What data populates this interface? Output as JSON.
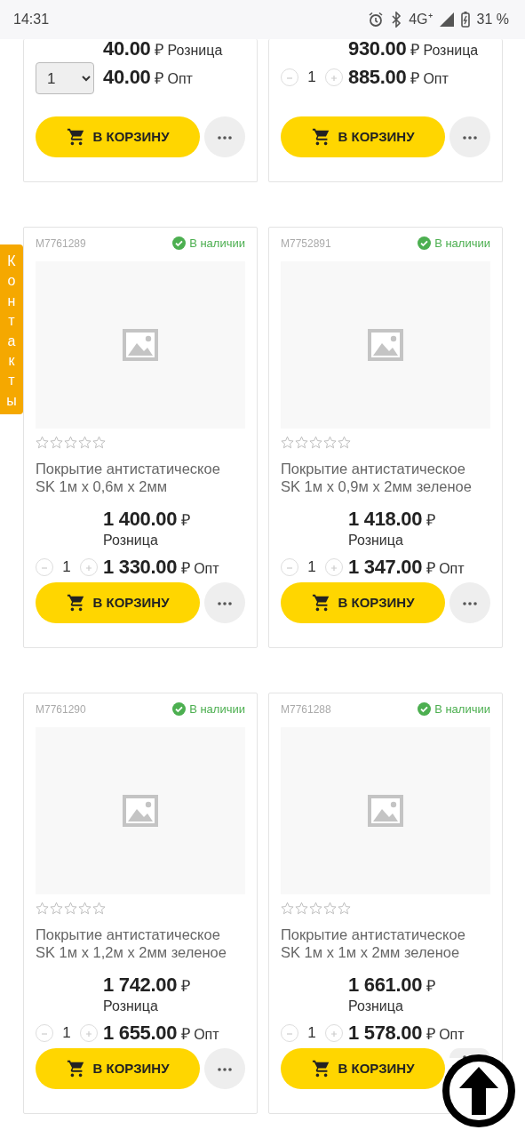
{
  "status_bar": {
    "time": "14:31",
    "network": "4G⁺",
    "battery": "31 %"
  },
  "side_tab": {
    "label": "Контакты"
  },
  "products": [
    {
      "retail_price": "40.00",
      "retail_currency": "₽",
      "retail_label": "Розница",
      "quantity": {
        "kind": "select",
        "value": "1"
      },
      "wholesale_price": "40.00",
      "wholesale_currency": "₽",
      "wholesale_label": "Опт",
      "button": "В КОРЗИНУ"
    },
    {
      "retail_price": "930.00",
      "retail_currency": "₽",
      "retail_label": "Розница",
      "quantity": {
        "kind": "stepper",
        "value": "1"
      },
      "wholesale_price": "885.00",
      "wholesale_currency": "₽",
      "wholesale_label": "Опт",
      "button": "В КОРЗИНУ"
    },
    {
      "code": "M7761289",
      "in_stock": true,
      "stock_label": "В наличии",
      "stars": 0,
      "title": "Покрытие антистатическое SK 1м х 0,6м х 2мм",
      "retail_price": "1 400.00",
      "retail_currency": "₽",
      "retail_label": "Розница",
      "quantity": {
        "kind": "stepper",
        "value": "1"
      },
      "wholesale_price": "1 330.00",
      "wholesale_currency": "₽",
      "wholesale_label": "Опт",
      "button": "В КОРЗИНУ"
    },
    {
      "code": "M7752891",
      "in_stock": true,
      "stock_label": "В наличии",
      "stars": 0,
      "title": "Покрытие антистатическое SK 1м х 0,9м х 2мм зеленое",
      "retail_price": "1 418.00",
      "retail_currency": "₽",
      "retail_label": "Розница",
      "quantity": {
        "kind": "stepper",
        "value": "1"
      },
      "wholesale_price": "1 347.00",
      "wholesale_currency": "₽",
      "wholesale_label": "Опт",
      "button": "В КОРЗИНУ"
    },
    {
      "code": "M7761290",
      "in_stock": true,
      "stock_label": "В наличии",
      "stars": 0,
      "title": "Покрытие антистатическое SK 1м х 1,2м х 2мм зеленое",
      "retail_price": "1 742.00",
      "retail_currency": "₽",
      "retail_label": "Розница",
      "quantity": {
        "kind": "stepper",
        "value": "1"
      },
      "wholesale_price": "1 655.00",
      "wholesale_currency": "₽",
      "wholesale_label": "Опт",
      "button": "В КОРЗИНУ"
    },
    {
      "code": "M7761288",
      "in_stock": true,
      "stock_label": "В наличии",
      "stars": 0,
      "title": "Покрытие антистатическое SK 1м х 1м х 2мм зеленое",
      "retail_price": "1 661.00",
      "retail_currency": "₽",
      "retail_label": "Розница",
      "quantity": {
        "kind": "stepper",
        "value": "1"
      },
      "wholesale_price": "1 578.00",
      "wholesale_currency": "₽",
      "wholesale_label": "Опт",
      "button": "В КОРЗИНУ"
    }
  ]
}
